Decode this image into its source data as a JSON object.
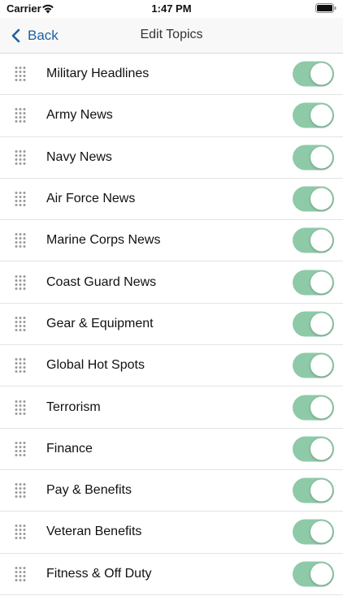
{
  "status_bar": {
    "carrier": "Carrier",
    "time": "1:47 PM",
    "wifi_icon": "wifi-icon",
    "battery_icon": "battery-icon"
  },
  "nav": {
    "back_label": "Back",
    "title": "Edit Topics",
    "accent_color": "#1f5fa0"
  },
  "toggle_color": "#8ecaa8",
  "topics": [
    {
      "label": "Military Headlines",
      "enabled": true
    },
    {
      "label": "Army News",
      "enabled": true
    },
    {
      "label": "Navy News",
      "enabled": true
    },
    {
      "label": "Air Force News",
      "enabled": true
    },
    {
      "label": "Marine Corps News",
      "enabled": true
    },
    {
      "label": "Coast Guard News",
      "enabled": true
    },
    {
      "label": "Gear & Equipment",
      "enabled": true
    },
    {
      "label": "Global Hot Spots",
      "enabled": true
    },
    {
      "label": "Terrorism",
      "enabled": true
    },
    {
      "label": "Finance",
      "enabled": true
    },
    {
      "label": "Pay & Benefits",
      "enabled": true
    },
    {
      "label": "Veteran Benefits",
      "enabled": true
    },
    {
      "label": "Fitness & Off Duty",
      "enabled": true
    }
  ]
}
